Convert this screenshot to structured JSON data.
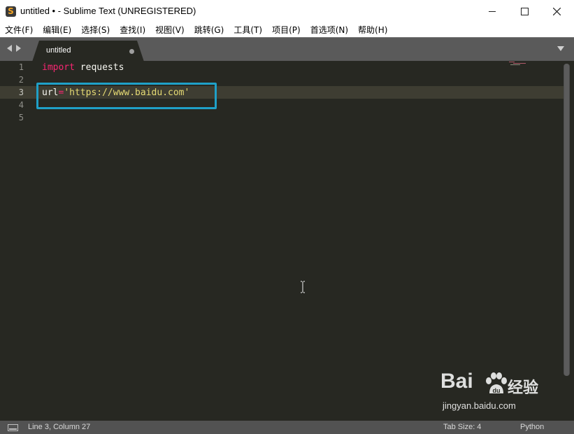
{
  "window": {
    "title": "untitled • - Sublime Text (UNREGISTERED)",
    "app_icon": "sublime-text-icon",
    "app_icon_glyph": "S",
    "controls": [
      "minimize-icon",
      "maximize-icon",
      "close-icon"
    ]
  },
  "menu": {
    "items": [
      "文件(F)",
      "编辑(E)",
      "选择(S)",
      "查找(I)",
      "视图(V)",
      "跳转(G)",
      "工具(T)",
      "项目(P)",
      "首选项(N)",
      "帮助(H)"
    ]
  },
  "tabs": {
    "active": {
      "label": "untitled",
      "dirty": true
    }
  },
  "editor": {
    "line_numbers": [
      "1",
      "2",
      "3",
      "4",
      "5"
    ],
    "active_line": 3,
    "lines": {
      "l1_keyword": "import",
      "l1_rest": " requests",
      "l3_var": "url",
      "l3_op": "=",
      "l3_string": "'https://www.baidu.com'"
    }
  },
  "status": {
    "position": "Line 3, Column 27",
    "tab_size": "Tab Size: 4",
    "syntax": "Python"
  },
  "watermark": {
    "brand_bai": "Bai",
    "brand_cn": "经验",
    "url": "jingyan.baidu.com"
  },
  "colors": {
    "editor_bg": "#272822",
    "keyword": "#f92672",
    "string": "#e6db74",
    "highlight_box": "#1fa0c8"
  }
}
